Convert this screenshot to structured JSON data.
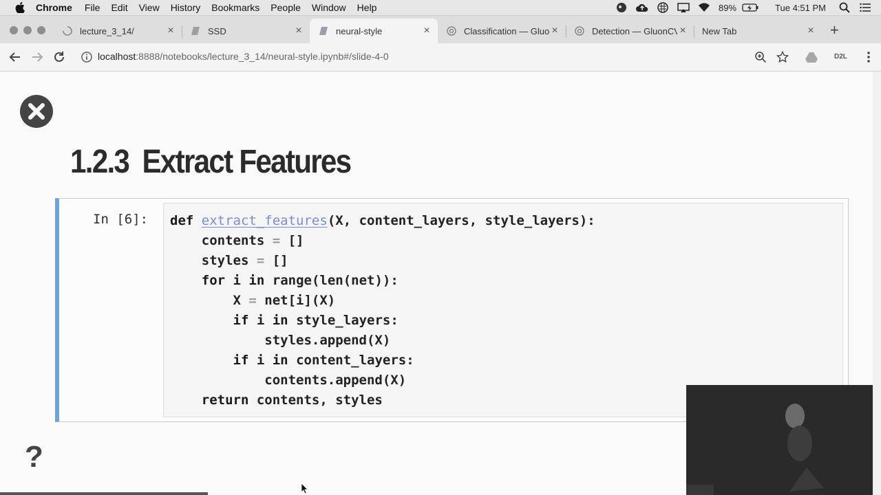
{
  "menubar": {
    "app_name": "Chrome",
    "items": [
      "File",
      "Edit",
      "View",
      "History",
      "Bookmarks",
      "People",
      "Window",
      "Help"
    ],
    "battery_text": "89%",
    "clock": "Tue 4:51 PM"
  },
  "tabs": [
    {
      "label": "lecture_3_14/",
      "active": false,
      "icon": "loading-icon"
    },
    {
      "label": "SSD",
      "active": false,
      "icon": "notebook-icon"
    },
    {
      "label": "neural-style",
      "active": true,
      "icon": "notebook-icon"
    },
    {
      "label": "Classification — Gluo",
      "active": false,
      "icon": "globe-icon"
    },
    {
      "label": "Detection — GluonCV",
      "active": false,
      "icon": "globe-icon"
    },
    {
      "label": "New Tab",
      "active": false,
      "icon": ""
    }
  ],
  "toolbar": {
    "url_host": "localhost",
    "url_rest": ":8888/notebooks/lecture_3_14/neural-style.ipynb#/slide-4-0",
    "extension_badge": "D2L"
  },
  "page": {
    "section_number": "1.2.3",
    "section_title": "Extract Features",
    "cell_prompt": "In [6]:",
    "code_lines": [
      "def extract_features(X, content_layers, style_layers):",
      "    contents = []",
      "    styles = []",
      "    for i in range(len(net)):",
      "        X = net[i](X)",
      "        if i in style_layers:",
      "            styles.append(X)",
      "        if i in content_layers:",
      "            contents.append(X)",
      "    return contents, styles"
    ],
    "help_glyph": "?"
  },
  "colors": {
    "cell_border_accent": "#6fa3d3",
    "function_name": "#7d8dc9",
    "menubar_bg": "#e6e6e6",
    "tabstrip_bg": "#dedede"
  }
}
